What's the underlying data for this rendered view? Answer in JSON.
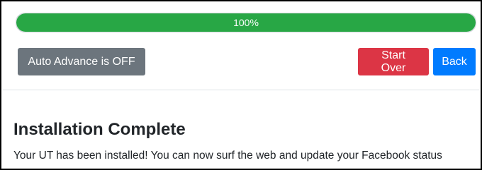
{
  "progress": {
    "value": 1.0,
    "label": "100%"
  },
  "toolbar": {
    "auto_advance_label": "Auto Advance is OFF",
    "start_over_label": "Start Over",
    "back_label": "Back"
  },
  "content": {
    "title": "Installation Complete",
    "message": "Your UT has been installed! You can now surf the web and update your Facebook status"
  },
  "colors": {
    "progress_fill": "#28a745",
    "auto_button": "#6c757d",
    "start_over_button": "#dc3545",
    "back_button": "#007bff"
  }
}
